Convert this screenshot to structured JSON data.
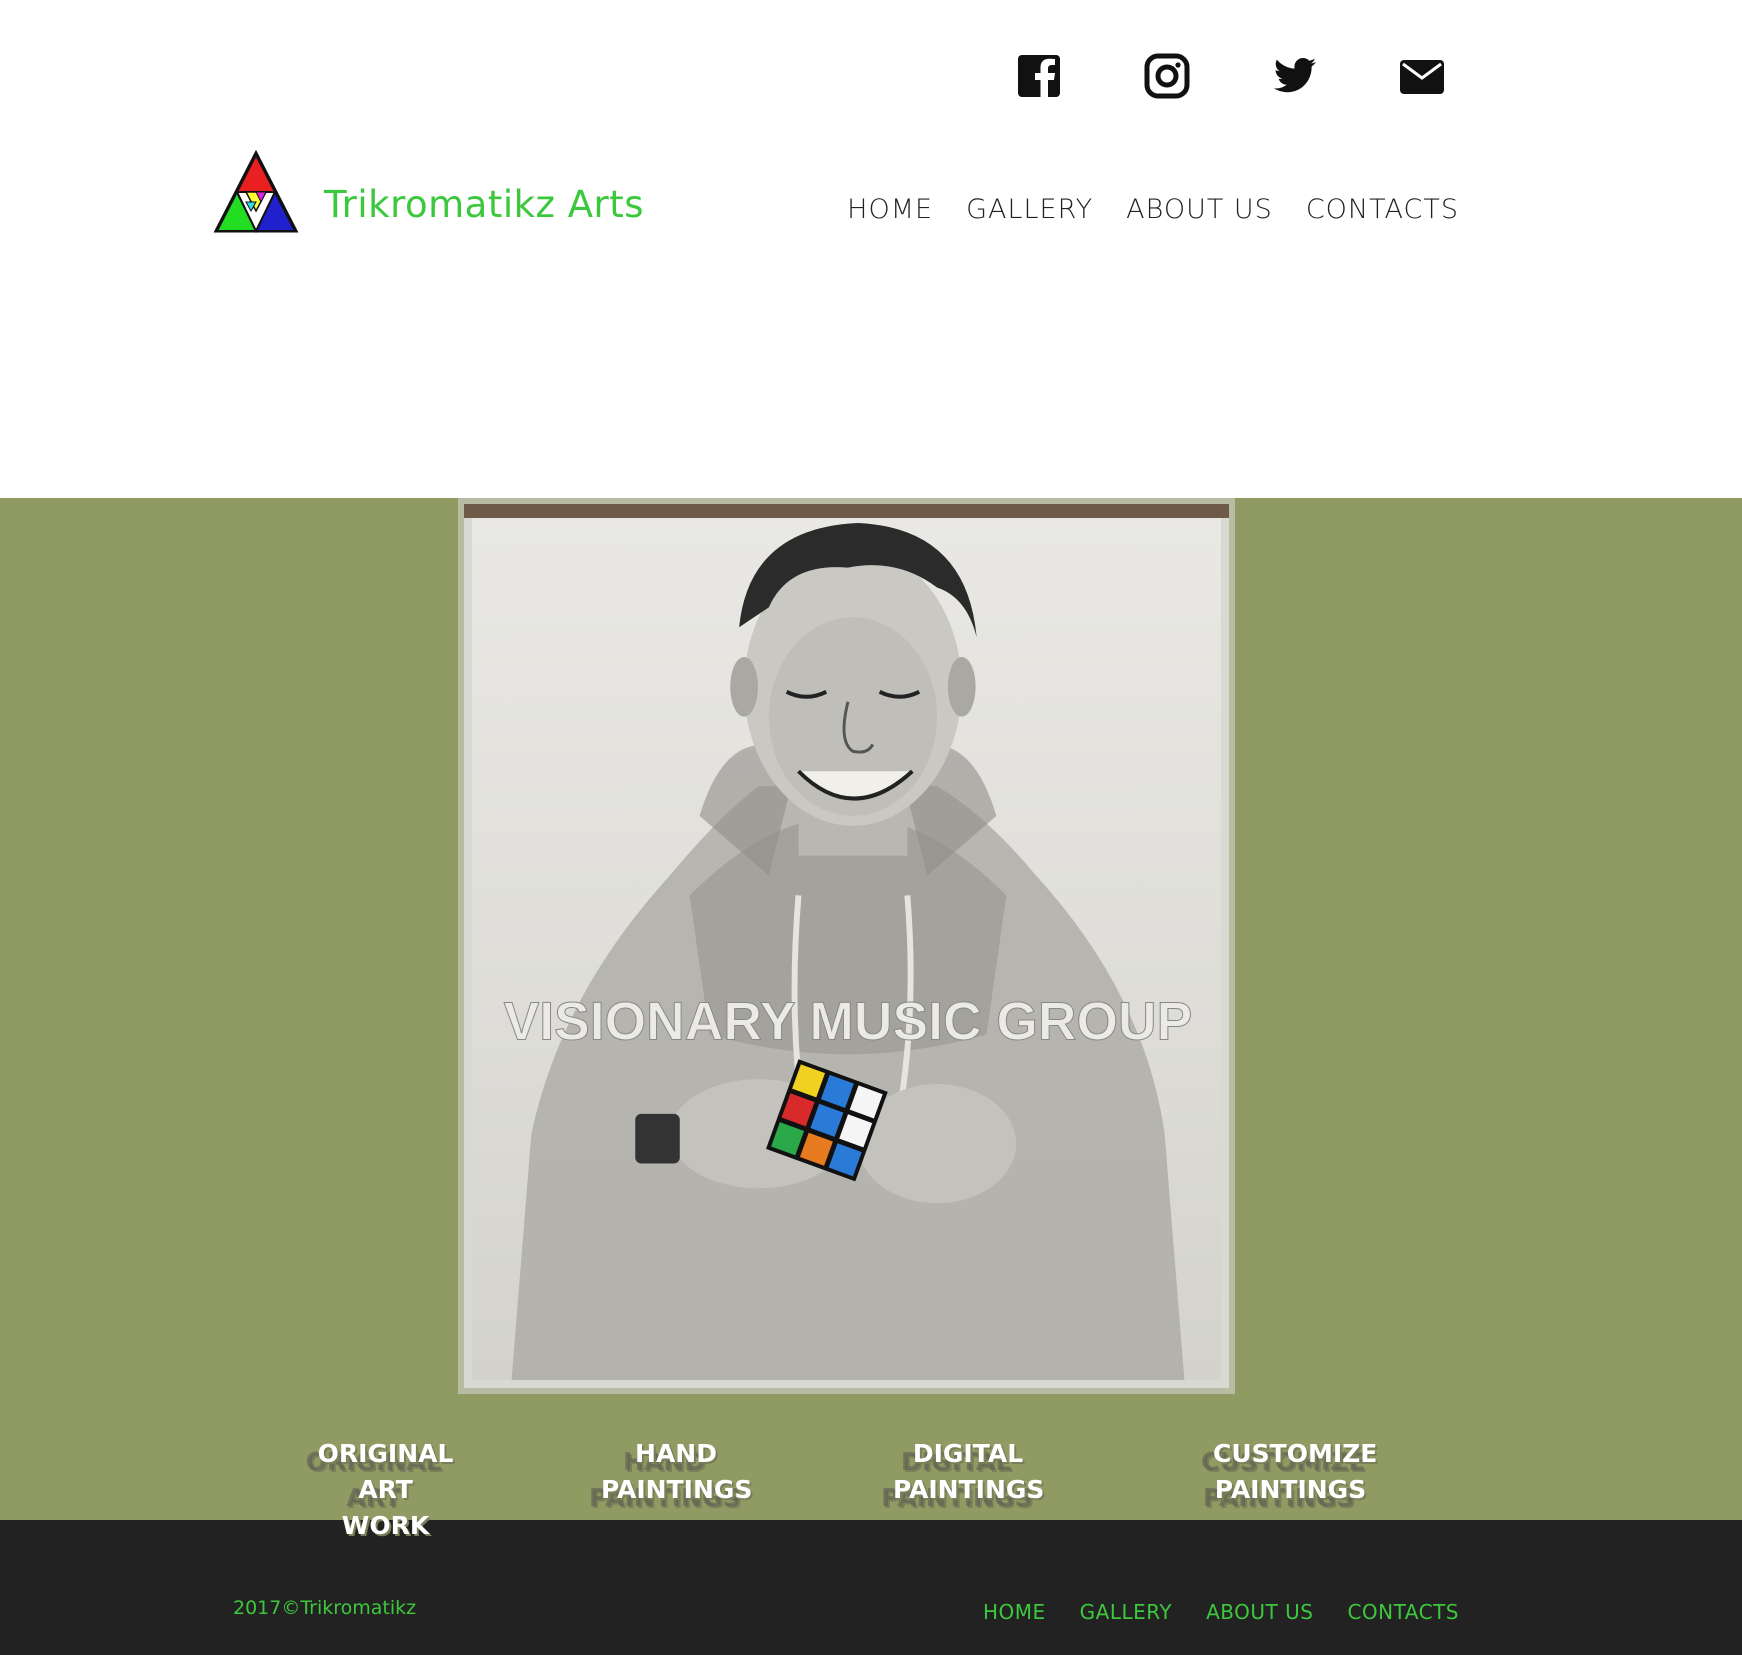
{
  "social": [
    {
      "name": "facebook-icon",
      "color": "#111111"
    },
    {
      "name": "instagram-icon",
      "color": "#111111"
    },
    {
      "name": "twitter-icon",
      "color": "#111111"
    },
    {
      "name": "envelope-icon",
      "color": "#111111"
    }
  ],
  "header": {
    "brand": "Trikromatikz Arts",
    "nav": [
      "HOME",
      "GALLERY",
      "ABOUT US",
      "CONTACTS"
    ]
  },
  "hero": {
    "painting_text": "VISIONARY MUSIC GROUP"
  },
  "categories": [
    [
      "ORIGINAL ART",
      "WORK"
    ],
    [
      "HAND",
      "PAINTINGS"
    ],
    [
      "DIGITAL",
      "PAINTINGS"
    ],
    [
      "CUSTOMIZE",
      "PAINTINGS"
    ]
  ],
  "footer": {
    "copyright": "2017©Trikromatikz",
    "nav": [
      "HOME",
      "GALLERY",
      "ABOUT US",
      "CONTACTS"
    ]
  },
  "colors": {
    "brand_green": "#3cc83c",
    "band_olive": "#909a63",
    "footer_dark": "#222222"
  }
}
